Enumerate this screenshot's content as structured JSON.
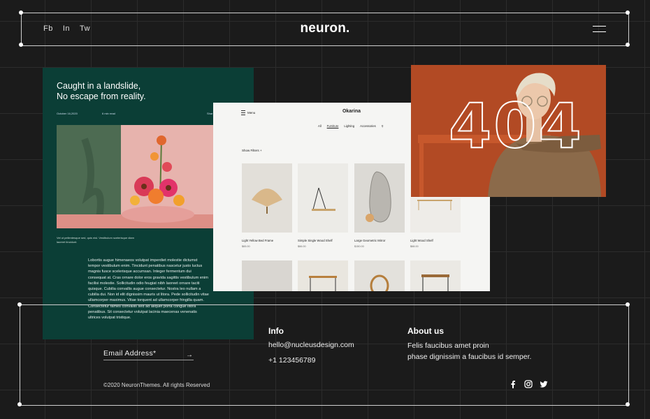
{
  "header": {
    "social": [
      "Fb",
      "In",
      "Tw"
    ],
    "logo": "neuron."
  },
  "card_green": {
    "title_line1": "Caught in a landslide,",
    "title_line2": "No escape from reality.",
    "meta": [
      "October 16,2020",
      "6 min read",
      "Shar"
    ],
    "caption": "Vel ut pellentesque sed, quis nisl. Vestibulum scelerisque diam laoreet tincidunt.",
    "body": "Lobortis augue himenaeos volutpat imperdiet molestie dictumst tempor vestibulum enim. Tincidunt penatibus nascetur justo luctus magnis fusce scelerisque accumsan. Integer fermentum dui consequat at. Cras ornare dolor eros gravida sagittis vestibulum enim facilisi molestie. Sollicitudin odio feugiat nibh laoreet ornare taciti quisque. Cubilia convallis augue consectetur. Nostra leo nullam a cubilia dui. Non id elit dignissim mauris ut litora. Pede sollicitudin vitae ullamcorper maximus. Vitae torquent ad ullamcorper fringilla quam. Consectetur fames convallis sed ad aliquet porta congue litora penatibus. Sit consectetur volutpat lacinia maecenas venenatis ultrices volutpat tristique."
  },
  "card_white": {
    "menu_label": "Menu",
    "title": "Okarina",
    "nav": [
      "All",
      "Furniture",
      "Lighting",
      "Accessories"
    ],
    "filter_label": "Show Filters",
    "products": [
      {
        "name": "Light Yellow Bed Frame",
        "price": "$65.00"
      },
      {
        "name": "Simple Single Wood Shelf",
        "price": "$66.00"
      },
      {
        "name": "Large Geometric Mirror",
        "price": "$150.00"
      },
      {
        "name": "Light Wood Shelf",
        "price": "$68.00"
      }
    ]
  },
  "card_404": {
    "code": "404"
  },
  "footer": {
    "email_placeholder": "Email  Address*",
    "info_heading": "Info",
    "info_email": "hello@nucleusdesign.com",
    "info_phone": "+1 123456789",
    "about_heading": "About us",
    "about_line1": "Felis faucibus amet proin",
    "about_line2": "phase dignissim a faucibus id semper.",
    "copyright": "©2020 NeuronThemes. All rights Reserved"
  },
  "colors": {
    "background": "#1b1b1b",
    "green": "#0b3e36",
    "orange": "#b24a24"
  },
  "icons": [
    "menu-icon",
    "search-icon",
    "arrow-right-icon",
    "facebook-icon",
    "instagram-icon",
    "twitter-icon"
  ]
}
